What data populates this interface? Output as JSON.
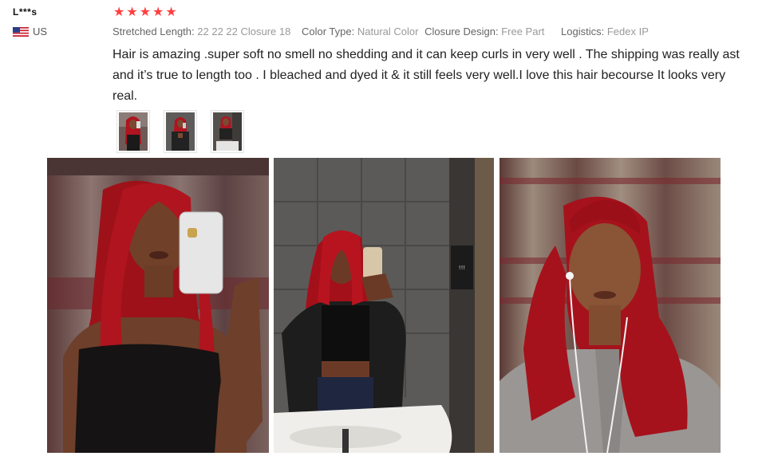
{
  "review": {
    "username": "L***s",
    "country": "US",
    "rating": 5,
    "stars": [
      "★",
      "★",
      "★",
      "★",
      "★"
    ],
    "attributes": [
      {
        "label": "Stretched Length:",
        "value": "22 22 22 Closure 18"
      },
      {
        "label": "Color Type:",
        "value": "Natural Color"
      },
      {
        "label": "Closure Design:",
        "value": "Free Part"
      },
      {
        "label": "Logistics:",
        "value": "Fedex IP"
      }
    ],
    "text": "Hair is amazing .super soft no smell no shedding and it can keep curls in very well . The shipping was really ast and it’s true to length too . I bleached and dyed it & it still feels very well.I love this hair becourse It looks very real."
  },
  "colors": {
    "star": "#ff3f3f",
    "hair": "#b0141e",
    "label": "#666666",
    "value": "#999999"
  },
  "photos": [
    {
      "name": "photo-mirror-selfie-black-top",
      "icon": "photo-thumbnail"
    },
    {
      "name": "photo-bathroom-mirror-jacket",
      "icon": "photo-thumbnail"
    },
    {
      "name": "photo-selfie-earphones",
      "icon": "photo-thumbnail"
    }
  ]
}
